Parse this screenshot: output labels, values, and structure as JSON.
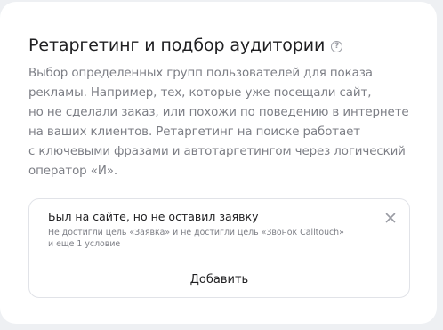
{
  "section": {
    "title": "Ретаргетинг и подбор аудитории",
    "help_icon_glyph": "?",
    "description_lines": [
      "Выбор определенных групп пользователей для показа",
      "рекламы. Например, тех, которые уже посещали сайт,",
      "но не сделали заказ, или похожи по поведению в интернете",
      "на ваших клиентов. Ретаргетинг на поиске работает",
      "с ключевыми фразами и автотаргетингом через логический",
      "оператор «И»."
    ]
  },
  "condition": {
    "title": "Был на сайте, но не оставил заявку",
    "details_lines": [
      "Не достигли цель «Заявка» и не достигли цель «Звонок Calltouch»",
      "и еще 1 условие"
    ],
    "close_icon": "close-icon"
  },
  "add_button": {
    "label": "Добавить"
  },
  "icons": {
    "help": "question-circle-icon",
    "close": "close-icon"
  },
  "colors": {
    "background": "#eef0f3",
    "card": "#ffffff",
    "title_text": "#1f1f21",
    "secondary_text": "#7c7e85",
    "border": "#e1e3e8"
  }
}
